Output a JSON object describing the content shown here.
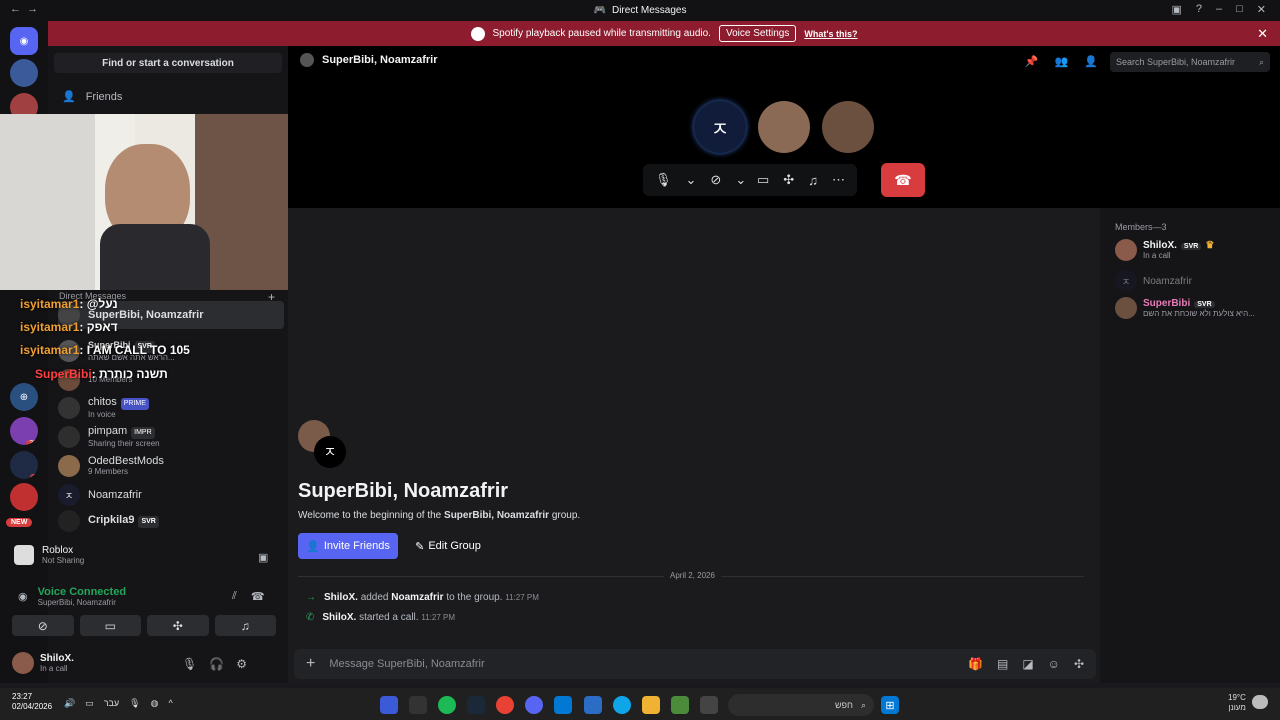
{
  "window": {
    "title": "Direct Messages"
  },
  "banner": {
    "text": "Spotify playback paused while transmitting audio.",
    "button": "Voice Settings",
    "link": "What's this?"
  },
  "sidebar": {
    "find_placeholder": "Find or start a conversation",
    "friends_label": "Friends",
    "dm_header": "Direct Messages",
    "dms": [
      {
        "name": "SuperBibi, Noamzafrir",
        "sub": ""
      },
      {
        "name": "SuperBibi",
        "tag": "SVR",
        "sub": "הראש אתה אשם שאתה..."
      },
      {
        "name": "",
        "sub": "10 Members"
      },
      {
        "name": "chitos",
        "tag": "PRIME",
        "sub": "In voice"
      },
      {
        "name": "pimpam",
        "tag": "IMPR",
        "sub": "Sharing their screen"
      },
      {
        "name": "OdedBestMods",
        "sub": "9 Members"
      },
      {
        "name": "Noamzafrir",
        "sub": ""
      },
      {
        "name": "Cripkila9",
        "tag": "SVR",
        "sub": ""
      }
    ],
    "chat_overlay": [
      {
        "user": "isyitamar1",
        "text": ": @נעל"
      },
      {
        "user": "isyitamar1",
        "text": ": דאפק"
      },
      {
        "user": "isyitamar1",
        "text": ": I AM CALL TO 105"
      },
      {
        "user": "SuperBibi",
        "text": ": תשנה כותרת"
      }
    ],
    "activity": {
      "title": "Roblox",
      "sub": "Not Sharing"
    },
    "voice": {
      "status": "Voice Connected",
      "channel": "SuperBibi, Noamzafrir"
    },
    "user": {
      "name": "ShiloX.",
      "status": "In a call"
    }
  },
  "guild_badges": [
    "2",
    "27",
    "2",
    "NEW"
  ],
  "channel": {
    "title": "SuperBibi, Noamzafrir",
    "search_placeholder": "Search SuperBibi, Noamzafrir"
  },
  "members": {
    "header": "Members—3",
    "list": [
      {
        "name": "ShiloX.",
        "tag": "SVR",
        "sub": "In a call"
      },
      {
        "name": "Noamzafrir",
        "tag": "",
        "sub": ""
      },
      {
        "name": "SuperBibi",
        "tag": "SVR",
        "sub": "היא צולעת ולא שוכחת את השם..."
      }
    ]
  },
  "welcome": {
    "title": "SuperBibi, Noamzafrir",
    "sub_prefix": "Welcome to the beginning of the",
    "sub_bold": "SuperBibi, Noamzafrir",
    "sub_suffix": "group.",
    "invite": "Invite Friends",
    "edit": "Edit Group"
  },
  "messages": {
    "date": "April 2, 2026",
    "items": [
      {
        "user": "ShiloX.",
        "action": "added",
        "target": "Noamzafrir",
        "rest": "to the group.",
        "time": "11:27 PM"
      },
      {
        "user": "ShiloX.",
        "action": "started a call.",
        "target": "",
        "rest": "",
        "time": "11:27 PM"
      }
    ]
  },
  "composer": {
    "placeholder": "Message SuperBibi, Noamzafrir"
  },
  "taskbar": {
    "time": "23:27",
    "date": "02/04/2026",
    "lang": "עבר",
    "search": "חפש",
    "weather_temp": "19°C",
    "weather_desc": "מעונן"
  },
  "colors": {
    "accent": "#5865f2",
    "danger": "#d83c3e",
    "banner": "#8c1c2e",
    "online": "#23a55a"
  }
}
